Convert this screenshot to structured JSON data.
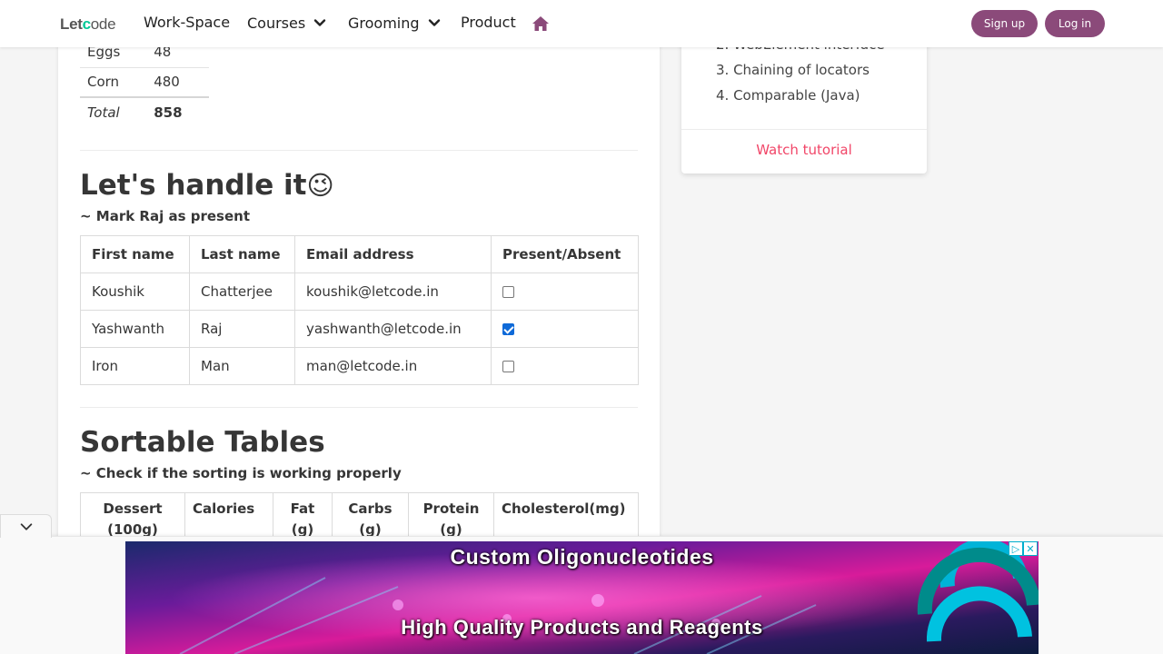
{
  "nav": {
    "logo_prefix": "Let",
    "logo_o": "c",
    "logo_suffix": "ode",
    "items": [
      {
        "label": "Work-Space"
      },
      {
        "label": "Courses"
      },
      {
        "label": "Grooming"
      },
      {
        "label": "Product"
      }
    ],
    "home_icon": "home-icon",
    "signup_label": "Sign up",
    "login_label": "Log in",
    "accent_color": "#8b4a7a"
  },
  "nutrition_table": {
    "rows": [
      {
        "name": "Eggs",
        "value": "48"
      },
      {
        "name": "Corn",
        "value": "480"
      }
    ],
    "total_label": "Total",
    "total_value": "858"
  },
  "handle_section": {
    "title": "Let's handle it",
    "emoji": "😉",
    "subtitle": "~ Mark Raj as present",
    "headers": [
      "First name",
      "Last name",
      "Email address",
      "Present/Absent"
    ],
    "rows": [
      {
        "first": "Koushik",
        "last": "Chatterjee",
        "email": "koushik@letcode.in",
        "present": false
      },
      {
        "first": "Yashwanth",
        "last": "Raj",
        "email": "yashwanth@letcode.in",
        "present": true
      },
      {
        "first": "Iron",
        "last": "Man",
        "email": "man@letcode.in",
        "present": false
      }
    ]
  },
  "sortable_section": {
    "title": "Sortable Tables",
    "subtitle": "~ Check if the sorting is working properly",
    "headers": [
      {
        "line1": "Dessert",
        "line2": "(100g)"
      },
      {
        "line1": "Calories",
        "line2": ""
      },
      {
        "line1": "Fat",
        "line2": "(g)"
      },
      {
        "line1": "Carbs",
        "line2": "(g)"
      },
      {
        "line1": "Protein",
        "line2": "(g)"
      },
      {
        "line1": "Cholesterol(mg)",
        "line2": ""
      }
    ]
  },
  "side_card": {
    "items": [
      "2. WebElement interface",
      "3. Chaining of locators",
      "4. Comparable (Java)"
    ],
    "watch_label": "Watch tutorial"
  },
  "ad": {
    "line1": "Custom Oligonucleotides",
    "line2": "High Quality Products and Reagents",
    "info_icon": "ad-info-icon",
    "close_icon": "ad-close-icon"
  }
}
